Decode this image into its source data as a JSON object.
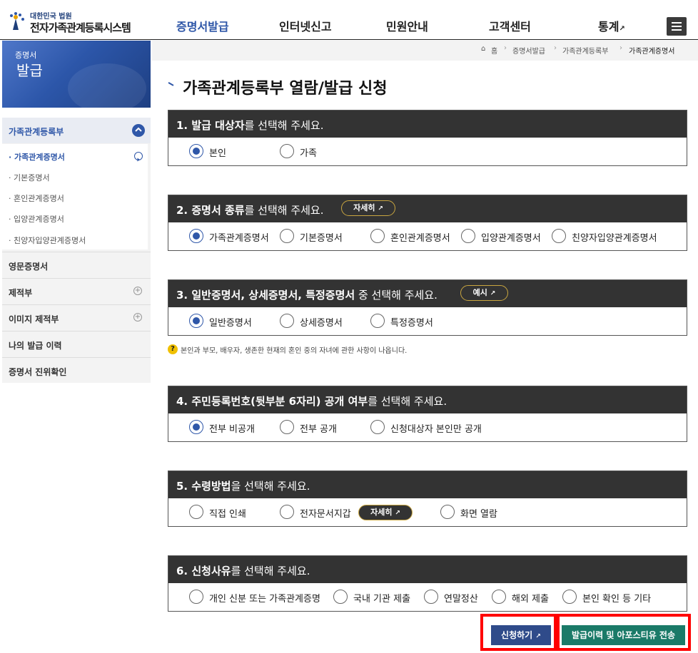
{
  "header": {
    "logo_sub": "대한민국 법원",
    "logo_main": "전자가족관계등록시스템",
    "nav": [
      "증명서발급",
      "인터넷신고",
      "민원안내",
      "고객센터",
      "통계"
    ],
    "active_nav": "증명서발급",
    "external_icon": "↗",
    "accent": "#2f57a8"
  },
  "banner": {
    "line1": "증명서",
    "line2": "발급"
  },
  "breadcrumb": [
    "홈",
    "증명서발급",
    "가족관계등록부",
    "가족관계증명서"
  ],
  "sidebar": {
    "group": "가족관계등록부",
    "sub_items": [
      "가족관계증명서",
      "기본증명서",
      "혼인관계증명서",
      "입양관계증명서",
      "친양자입양관계증명서"
    ],
    "items": [
      "영문증명서",
      "제적부",
      "이미지 제적부",
      "나의 발급 이력",
      "증명서 진위확인"
    ]
  },
  "page_title": "가족관계등록부 열람/발급 신청",
  "sections": [
    {
      "head_bold": "1. 발급 대상자",
      "head_rest": "를 선택해 주세요.",
      "options": [
        "본인",
        "가족"
      ],
      "selected": 0
    },
    {
      "head_bold": "2. 증명서 종류",
      "head_rest": "를 선택해 주세요.",
      "pill": "자세히",
      "options": [
        "가족관계증명서",
        "기본증명서",
        "혼인관계증명서",
        "입양관계증명서",
        "친양자입양관계증명서"
      ],
      "selected": 0
    },
    {
      "head_bold": "3. 일반증명서, 상세증명서, 특정증명서",
      "head_rest": " 중 선택해 주세요.",
      "pill": "예시",
      "options": [
        "일반증명서",
        "상세증명서",
        "특정증명서"
      ],
      "selected": 0
    },
    {
      "head_bold": "4. 주민등록번호(뒷부분 6자리) 공개 여부",
      "head_rest": "를 선택해 주세요.",
      "options": [
        "전부 비공개",
        "전부 공개",
        "신청대상자 본인만 공개"
      ],
      "selected": 0
    },
    {
      "head_bold": "5. 수령방법",
      "head_rest": "을 선택해 주세요.",
      "inline_pill": "자세히",
      "options": [
        "직접 인쇄",
        "전자문서지갑",
        "화면 열람"
      ],
      "selected": -1
    },
    {
      "head_bold": "6. 신청사유",
      "head_rest": "를 선택해 주세요.",
      "options": [
        "개인 신분 또는 가족관계증명",
        "국내 기관 제출",
        "연말정산",
        "해외 제출",
        "본인 확인 등 기타"
      ],
      "selected": -1
    }
  ],
  "note": "본인과 부모, 배우자, 생존한 현재의 혼인 중의 자녀에 관한 사항이 나옵니다.",
  "buttons": {
    "apply": "신청하기",
    "history": "발급이력 및 아포스티유 전송",
    "apply_color": "#2f4b8a",
    "history_color": "#1a7a68",
    "highlight_color": "#ff0000"
  }
}
